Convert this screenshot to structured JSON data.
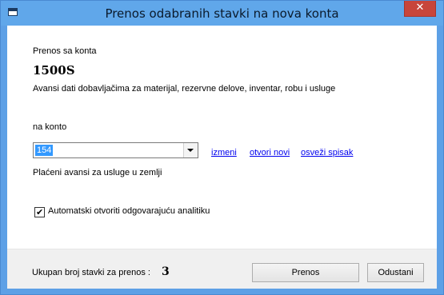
{
  "window": {
    "title": "Prenos odabranih stavki na nova konta",
    "close_label": "✕"
  },
  "source": {
    "heading": "Prenos sa konta",
    "account": "1500S",
    "description": "Avansi dati dobavljačima za materijal, rezervne delove, inventar, robu i usluge"
  },
  "target": {
    "heading": "na konto",
    "account_value": "154",
    "description": "Plaćeni avansi za usluge u zemlji"
  },
  "links": {
    "edit": "izmeni",
    "open_new": "otvori novi",
    "refresh": "osveži spisak"
  },
  "options": {
    "auto_analytics_label": "Automatski otvoriti odgovarajuću analitiku",
    "auto_analytics_checked": true
  },
  "footer": {
    "count_label": "Ukupan broj stavki za prenos :",
    "count_value": "3",
    "transfer_button": "Prenos",
    "cancel_button": "Odustani"
  }
}
